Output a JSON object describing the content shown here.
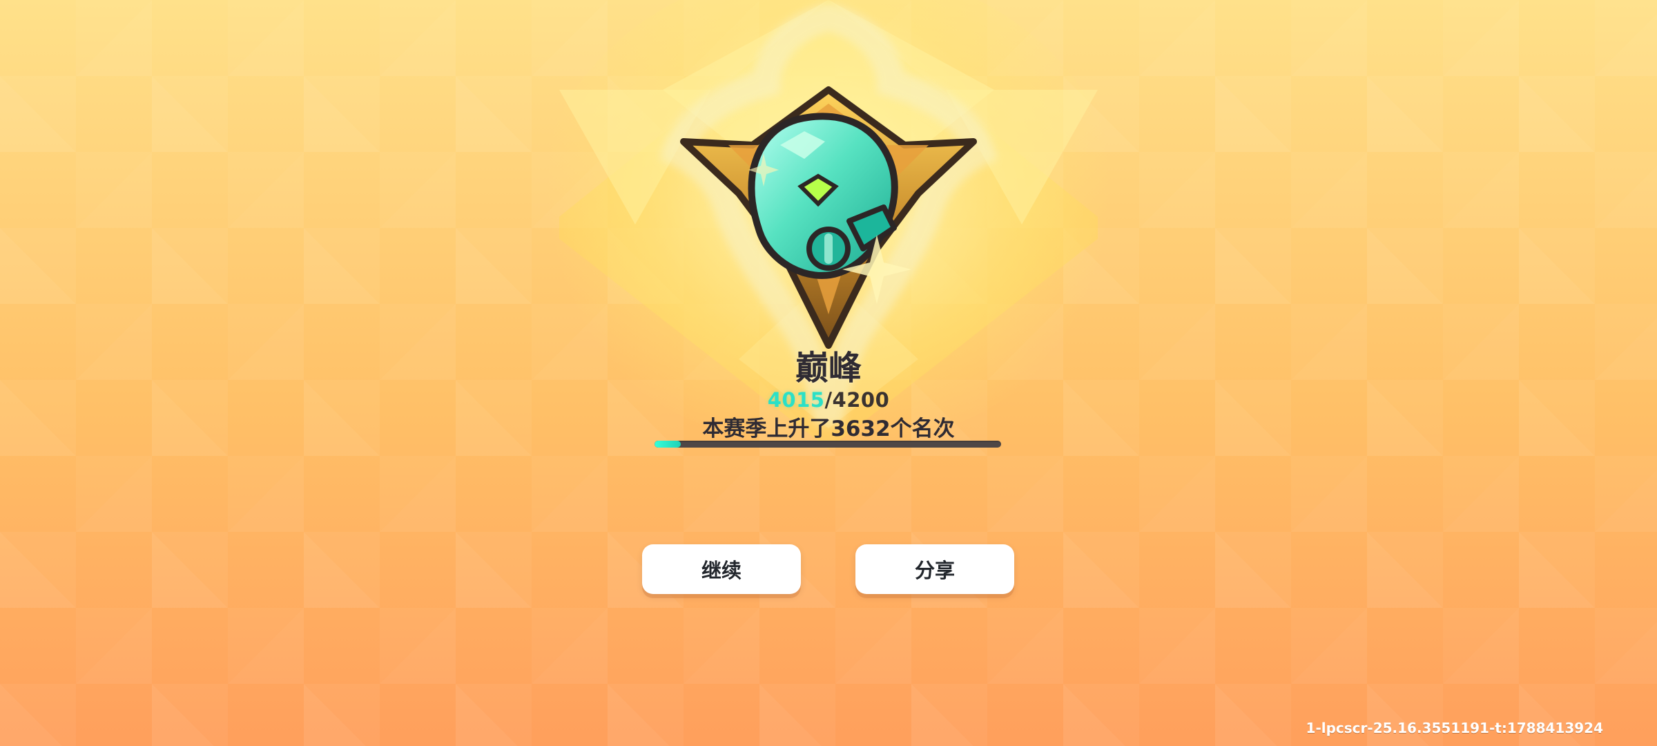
{
  "rank": {
    "name": "巅峰",
    "score_current": "4015",
    "score_separator": "/",
    "score_total": "4200",
    "progress_fraction": 0.075,
    "season_text": "本赛季上升了3632个名次"
  },
  "buttons": {
    "continue_label": "继续",
    "share_label": "分享"
  },
  "footer": {
    "build_text": "1-lpcscr-25.16.3551191-t:1788413924"
  },
  "colors": {
    "accent_teal": "#2be0c7",
    "background_top": "#ffe18a",
    "background_bottom": "#ff9f5c",
    "button_bg": "#ffffff"
  },
  "icons": {
    "emblem": "peak-rank-emblem-icon"
  }
}
